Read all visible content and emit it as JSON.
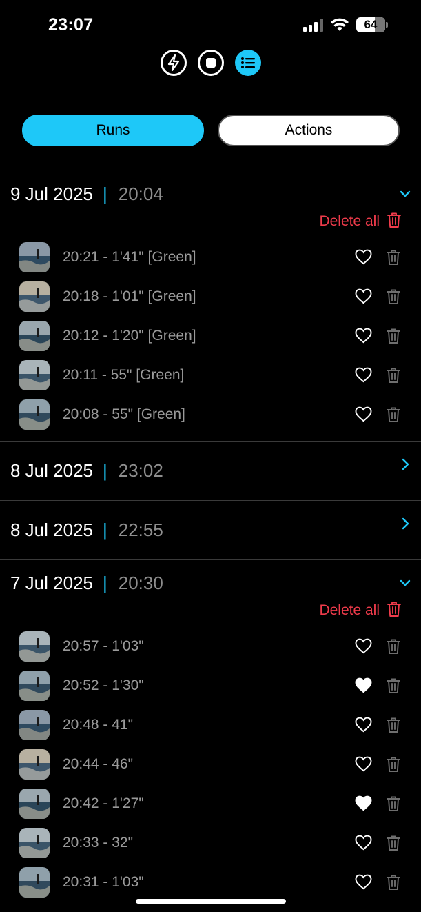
{
  "status_bar": {
    "time": "23:07",
    "battery": "64"
  },
  "mode_icons": [
    {
      "name": "lightning-icon"
    },
    {
      "name": "stop-icon"
    },
    {
      "name": "list-icon"
    }
  ],
  "tabs": [
    {
      "label": "Runs",
      "active": true
    },
    {
      "label": "Actions",
      "active": false
    }
  ],
  "colors": {
    "accent": "#1ec8f8",
    "danger": "#ef3b4b",
    "muted": "#8e8e8e"
  },
  "sessions": [
    {
      "date": "9 Jul 2025",
      "time": "20:04",
      "expanded": true,
      "delete_all": "Delete all",
      "runs": [
        {
          "label": "20:21 - 1'41\" [Green]",
          "favorite": false
        },
        {
          "label": "20:18 - 1'01\" [Green]",
          "favorite": false
        },
        {
          "label": "20:12 - 1'20\" [Green]",
          "favorite": false
        },
        {
          "label": "20:11 - 55\" [Green]",
          "favorite": false
        },
        {
          "label": "20:08 - 55\" [Green]",
          "favorite": false
        }
      ]
    },
    {
      "date": "8 Jul 2025",
      "time": "23:02",
      "expanded": false
    },
    {
      "date": "8 Jul 2025",
      "time": "22:55",
      "expanded": false
    },
    {
      "date": "7 Jul 2025",
      "time": "20:30",
      "expanded": true,
      "delete_all": "Delete all",
      "runs": [
        {
          "label": "20:57 - 1'03\"",
          "favorite": false
        },
        {
          "label": "20:52 - 1'30\"",
          "favorite": true
        },
        {
          "label": "20:48 - 41\"",
          "favorite": false
        },
        {
          "label": "20:44 - 46\"",
          "favorite": false
        },
        {
          "label": "20:42 - 1'27\"",
          "favorite": true
        },
        {
          "label": "20:33 - 32\"",
          "favorite": false
        },
        {
          "label": "20:31 - 1'03\"",
          "favorite": false
        }
      ]
    }
  ]
}
